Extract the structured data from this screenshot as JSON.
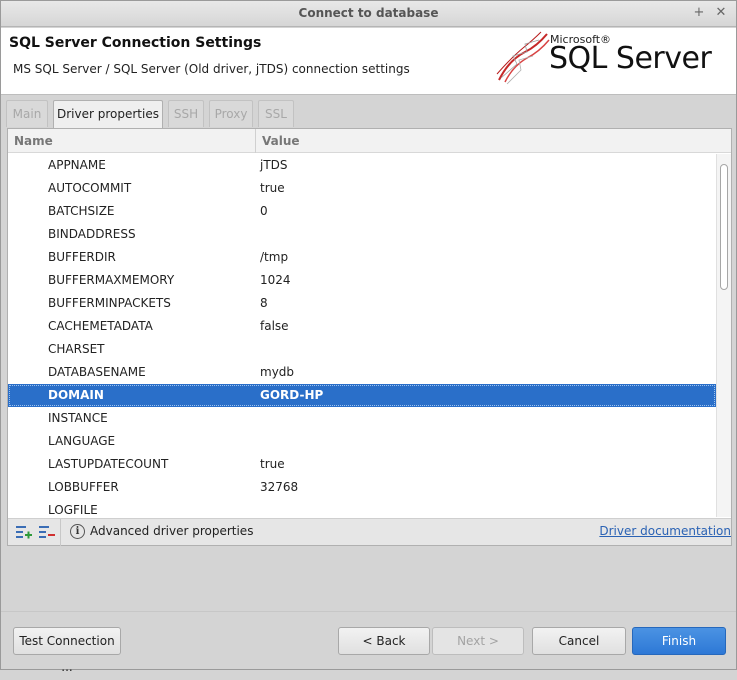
{
  "window": {
    "title": "Connect to database"
  },
  "header": {
    "title": "SQL Server Connection Settings",
    "subtitle": "MS SQL Server / SQL Server (Old driver, jTDS) connection settings",
    "logo_small": "Microsoft®",
    "logo_big": "SQL Server"
  },
  "tabs": [
    {
      "label": "Main"
    },
    {
      "label": "Driver properties"
    },
    {
      "label": "SSH"
    },
    {
      "label": "Proxy"
    },
    {
      "label": "SSL"
    }
  ],
  "table": {
    "columns": {
      "name": "Name",
      "value": "Value"
    },
    "rows": [
      {
        "name": "APPNAME",
        "value": "jTDS"
      },
      {
        "name": "AUTOCOMMIT",
        "value": "true"
      },
      {
        "name": "BATCHSIZE",
        "value": "0"
      },
      {
        "name": "BINDADDRESS",
        "value": ""
      },
      {
        "name": "BUFFERDIR",
        "value": "/tmp"
      },
      {
        "name": "BUFFERMAXMEMORY",
        "value": "1024"
      },
      {
        "name": "BUFFERMINPACKETS",
        "value": "8"
      },
      {
        "name": "CACHEMETADATA",
        "value": "false"
      },
      {
        "name": "CHARSET",
        "value": ""
      },
      {
        "name": "DATABASENAME",
        "value": "mydb"
      },
      {
        "name": "DOMAIN",
        "value": "GORD-HP"
      },
      {
        "name": "INSTANCE",
        "value": ""
      },
      {
        "name": "LANGUAGE",
        "value": ""
      },
      {
        "name": "LASTUPDATECOUNT",
        "value": "true"
      },
      {
        "name": "LOBBUFFER",
        "value": "32768"
      },
      {
        "name": "LOGFILE",
        "value": ""
      }
    ],
    "selected_row": "DOMAIN"
  },
  "panel_bar": {
    "advanced_label": "Advanced driver properties",
    "doc_link": "Driver documentation"
  },
  "buttons": {
    "test": "Test Connection ...",
    "back": "< Back",
    "next": "Next >",
    "cancel": "Cancel",
    "finish": "Finish"
  },
  "colors": {
    "selection": "#2a6fc9",
    "primary_button": "#2d78d6",
    "link": "#2a62b4"
  }
}
